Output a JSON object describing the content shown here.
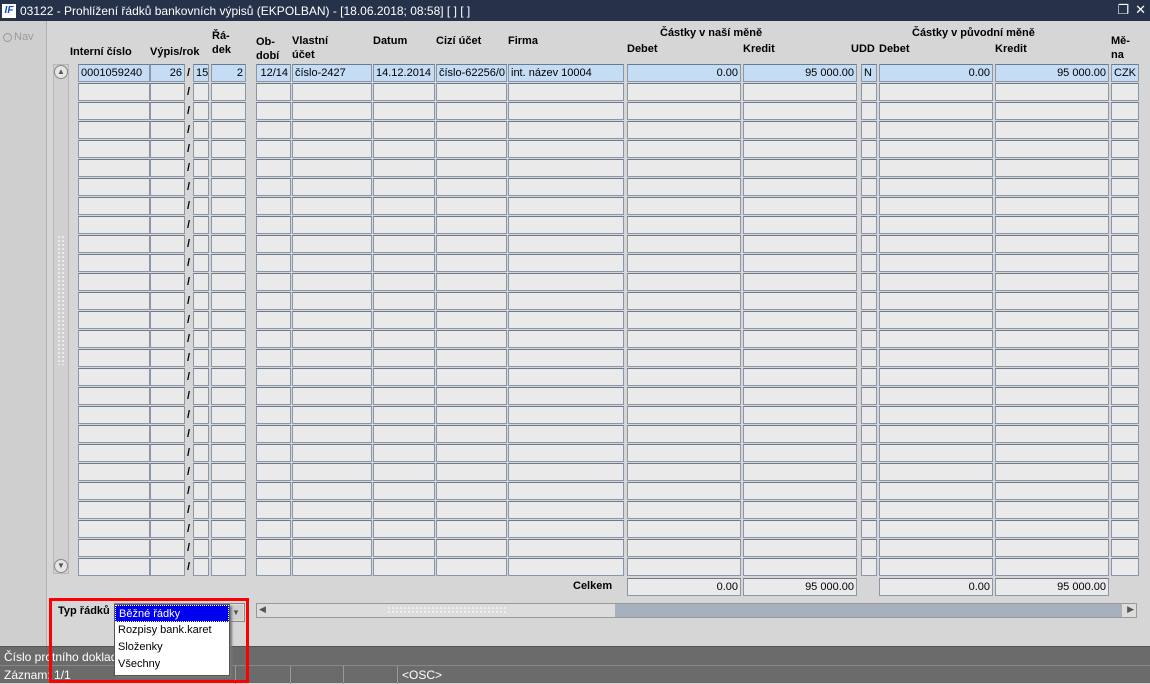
{
  "window": {
    "title": "03122 - Prohlížení řádků bankovních výpisů (EKPOLBAN) - [18.06.2018; 08:58]  [ ] [ ]",
    "logo": "IF",
    "restore_icon": "❐",
    "close_icon": "✕"
  },
  "nav": {
    "label": "Nav"
  },
  "headers": {
    "interni": "Interní číslo",
    "vypis": "Výpis/rok",
    "radek": "Řá-\ndek",
    "obdobi": "Ob-\ndobí",
    "vlastni": "Vlastní\núčet",
    "datum": "Datum",
    "cizi": "Cizí účet",
    "firma": "Firma",
    "nase_group": "Částky v naší měně",
    "puvodni_group": "Částky v původní měně",
    "debet": "Debet",
    "kredit": "Kredit",
    "udd": "UDD",
    "debet2": "Debet",
    "kredit2": "Kredit",
    "mena": "Mě-\nna"
  },
  "rows": [
    {
      "interni": "0001059240",
      "vypis": "26",
      "rok": "15",
      "radek": "2",
      "obdobi": "12/14",
      "vlastni": "číslo-2427",
      "datum": "14.12.2014",
      "cizi": "číslo-62256/0:",
      "firma": "int. název 10004",
      "debet": "0.00",
      "kredit": "95 000.00",
      "udd": "N",
      "debet2": "0.00",
      "kredit2": "95 000.00",
      "mena": "CZK"
    }
  ],
  "empty_rows": 26,
  "separator": "/",
  "totals": {
    "label": "Celkem",
    "debet": "0.00",
    "kredit": "95 000.00",
    "debet2": "0.00",
    "kredit2": "95 000.00"
  },
  "typ_radku": {
    "label": "Typ řádků",
    "selected": "Běžné řádky",
    "options": [
      "Běžné řádky",
      "Rozpisy bank.karet",
      "Složenky",
      "Všechny"
    ]
  },
  "status": {
    "line1": "Číslo protního dokladu",
    "record": "Záznam: 1/1",
    "mode": "<OSC>"
  }
}
